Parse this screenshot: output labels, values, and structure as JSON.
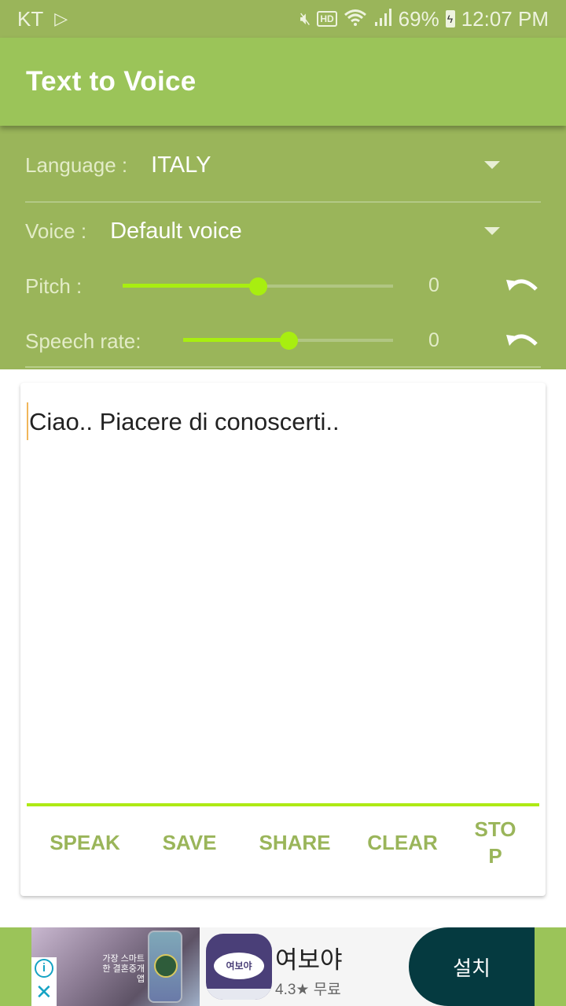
{
  "status_bar": {
    "carrier": "KT",
    "battery_percent": "69%",
    "time": "12:07 PM",
    "icons": [
      "play-store-icon",
      "mute-icon",
      "hd-voice-icon",
      "wifi-icon",
      "signal-icon",
      "battery-charging-icon"
    ]
  },
  "app_bar": {
    "title": "Text to Voice"
  },
  "settings": {
    "language": {
      "label": "Language :",
      "value": "ITALY"
    },
    "voice": {
      "label": "Voice :",
      "value": "Default voice"
    },
    "pitch": {
      "label": "Pitch :",
      "value": "0",
      "slider_fraction": 0.5
    },
    "speech_rate": {
      "label": "Speech rate:",
      "value": "0",
      "slider_fraction": 0.5
    }
  },
  "editor": {
    "text": "Ciao.. Piacere di conoscerti.."
  },
  "actions": {
    "speak": "SPEAK",
    "save": "SAVE",
    "share": "SHARE",
    "clear": "CLEAR",
    "stop_line1": "STO",
    "stop_line2": "P"
  },
  "ad": {
    "photo_text": "가장 스마트한 결혼중개앱",
    "app_icon_text": "여보야",
    "app_name": "여보야",
    "rating": "4.3",
    "star": "★",
    "price": "무료",
    "install_label": "설치",
    "info_glyph": "i",
    "close_glyph": "✕"
  },
  "colors": {
    "status_bar": "#9ab55a",
    "app_bar": "#9bc459",
    "accent": "#a8ee10",
    "button_text": "#9ab55a",
    "install_button": "#053a40"
  }
}
